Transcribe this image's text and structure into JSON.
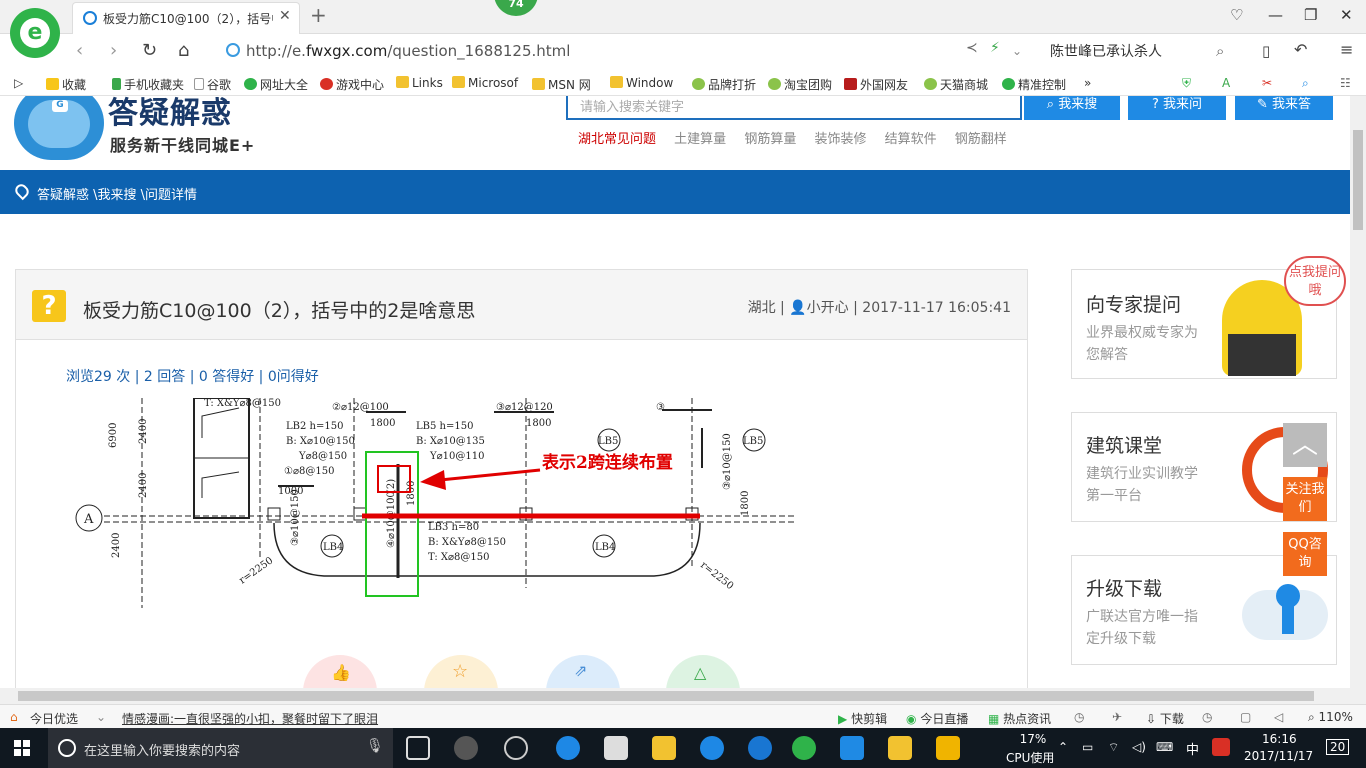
{
  "browser": {
    "tab_title": "板受力筋C10@100（2），括号中",
    "badge": "74",
    "url_prefix": "http://e.",
    "url_domain": "fwxgx.com",
    "url_path": "/question_1688125.html",
    "search_text": "陈世峰已承认杀人"
  },
  "bookmarks": [
    "收藏",
    "手机收藏夹",
    "谷歌",
    "网址大全",
    "游戏中心",
    "Links",
    "Microsof",
    "MSN 网",
    "Window",
    "品牌打折",
    "淘宝团购",
    "外国网友",
    "天猫商城",
    "精准控制"
  ],
  "site": {
    "name": "答疑解惑",
    "subtitle": "服务新干线同城E+",
    "search_placeholder": "请输入搜索关键字",
    "buttons": [
      "我来搜",
      "我来问",
      "我来答"
    ],
    "hot_links": [
      "湖北常见问题",
      "土建算量",
      "钢筋算量",
      "装饰装修",
      "结算软件",
      "钢筋翻样"
    ],
    "breadcrumb": "答疑解惑 \\我来搜 \\问题详情"
  },
  "question": {
    "icon": "?",
    "title": "板受力筋C10@100（2），括号中的2是啥意思",
    "meta_location": "湖北",
    "meta_user": "小开心",
    "meta_time": "2017-11-17 16:05:41",
    "stats": "浏览29 次 | 2 回答 | 0 答得好 | 0问得好"
  },
  "drawing": {
    "annotation": "表示2跨连续布置",
    "labels": {
      "top_t": "T: X&Y⌀8@150",
      "axis_a": "A",
      "dim_6900": "6900",
      "dim_2400a": "2400",
      "dim_2400b": "2400",
      "dim_2400c": "2400",
      "lb2_name": "LB2  h=150",
      "lb2_bx": "B: X⌀10@150",
      "lb2_by": "Y⌀8@150",
      "lb2_extra": "①⌀8@150",
      "dim_1000": "1000",
      "top_2": "②⌀12@100",
      "dim_1800a": "1800",
      "lb5_name": "LB5  h=150",
      "lb5_bx": "B: X⌀10@135",
      "lb5_by": "Y⌀10@110",
      "top_3": "③⌀12@120",
      "dim_1800b": "1800",
      "top_3b": "③",
      "lb5a": "LB5",
      "lb5b": "LB5",
      "v_2": "(2)",
      "v_1800": "1800",
      "v_c10": "④⌀10@100",
      "v_1800c": "1800",
      "v_r": "③⌀10@150",
      "lb3_name": "LB3  h=80",
      "lb3_bx": "B: X&Y⌀8@150",
      "lb3_by": "T: X⌀8@150",
      "lb4a": "LB4",
      "lb4b": "LB4",
      "r_left": "r=2250",
      "r_right": "r=2250",
      "v_left": "③⌀10@150"
    }
  },
  "sidebar": {
    "cards": [
      {
        "title": "向专家提问",
        "desc": "业界最权威专家为您解答",
        "bubble": "点我提问哦"
      },
      {
        "title": "建筑课堂",
        "desc": "建筑行业实训教学第一平台"
      },
      {
        "title": "升级下载",
        "desc": "广联达官方唯一指定升级下载"
      }
    ],
    "float_follow": "关注我们",
    "float_qq": "QQ咨询"
  },
  "statusbar": {
    "today": "今日优选",
    "news": "情感漫画:一直很坚强的小扣，聚餐时留下了眼泪",
    "items": [
      "快剪辑",
      "今日直播",
      "热点资讯"
    ],
    "download": "下载",
    "zoom": "110%"
  },
  "taskbar": {
    "search_placeholder": "在这里输入你要搜索的内容",
    "cpu_percent": "17%",
    "cpu_label": "CPU使用",
    "ime": "中",
    "time": "16:16",
    "date": "2017/11/17",
    "notif": "20"
  },
  "colors": {
    "brand_blue": "#0d62b0",
    "accent_orange": "#f26b1d",
    "annotation_red": "#e00000",
    "highlight_green": "#22c422"
  }
}
